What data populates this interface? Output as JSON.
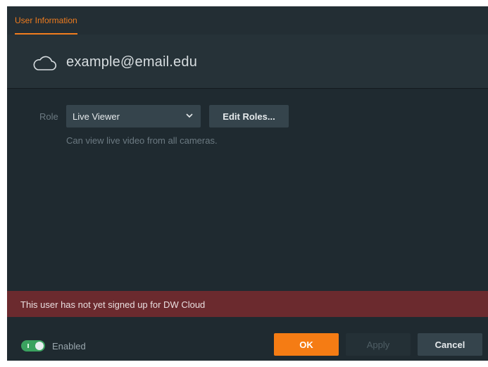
{
  "tabs": [
    {
      "label": "User Information",
      "active": true
    }
  ],
  "user": {
    "email": "example@email.edu",
    "icon": "cloud-icon"
  },
  "role": {
    "label": "Role",
    "selected": "Live Viewer",
    "edit_button": "Edit Roles...",
    "description": "Can view live video from all cameras."
  },
  "warning": {
    "text": "This user has not yet signed up for DW Cloud"
  },
  "footer": {
    "enabled_label": "Enabled",
    "enabled": true,
    "ok_label": "OK",
    "apply_label": "Apply",
    "cancel_label": "Cancel"
  },
  "colors": {
    "accent": "#f57c14",
    "warning_bg": "#6b2a2e",
    "toggle_on": "#3aa25f"
  }
}
